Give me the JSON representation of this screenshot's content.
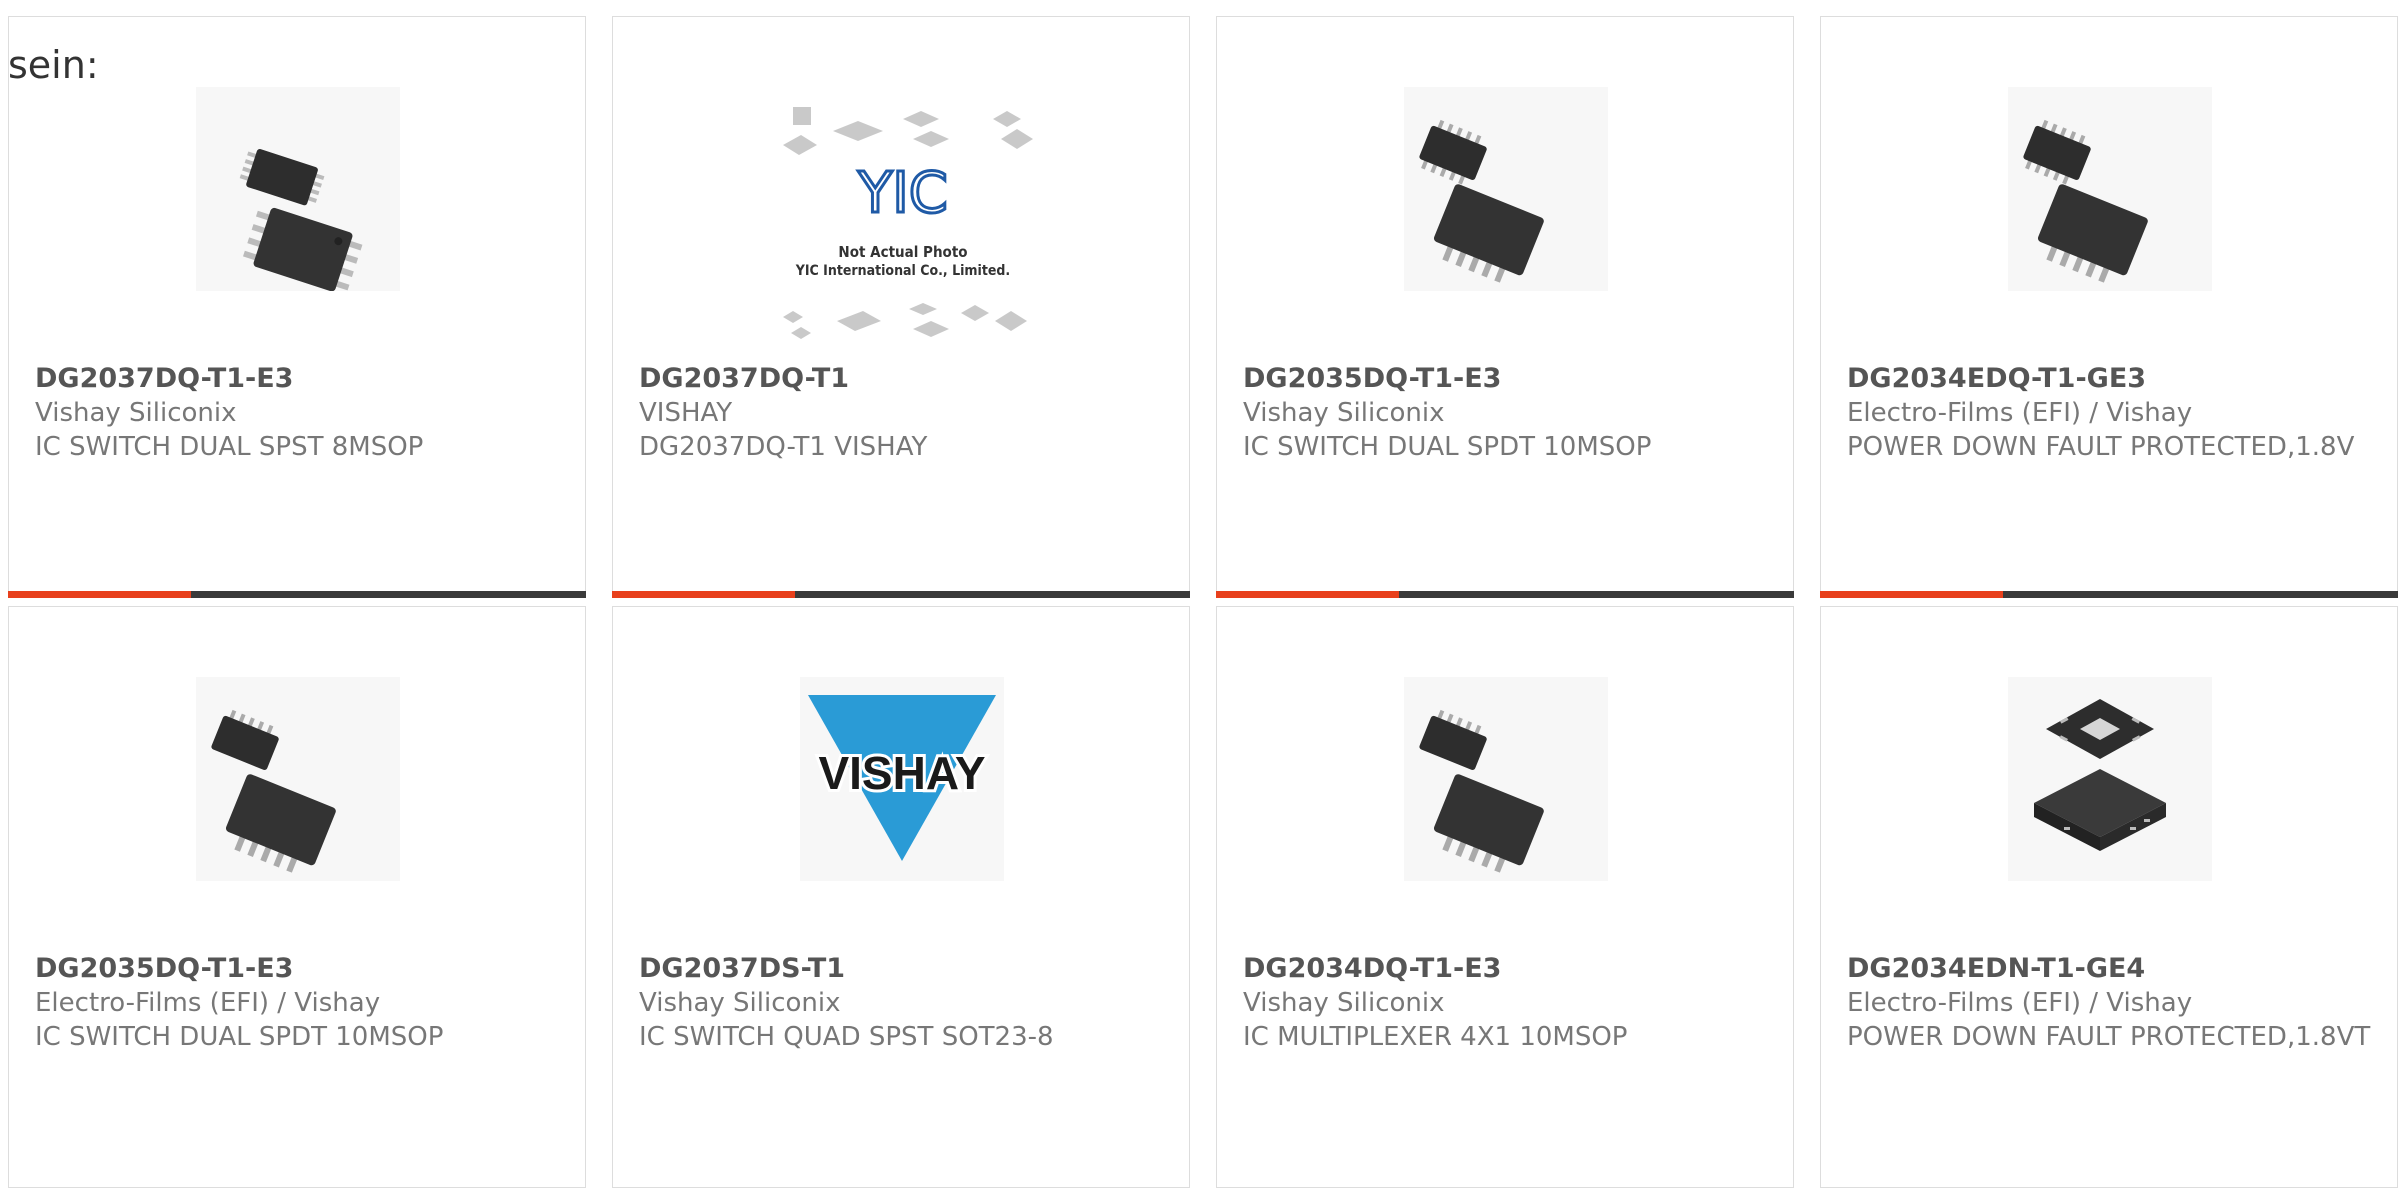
{
  "page": {
    "lead_text": "sein:",
    "accent_color": "#e8401c",
    "bar_color": "#3a3a3a"
  },
  "products": [
    {
      "part_number": "DG2037DQ-T1-E3",
      "manufacturer": "Vishay Siliconix",
      "description": "IC SWITCH DUAL SPST 8MSOP",
      "image": "msop-8-chip-photo",
      "has_accent_bar": true
    },
    {
      "part_number": "DG2037DQ-T1",
      "manufacturer": "VISHAY",
      "description": "DG2037DQ-T1 VISHAY",
      "image": "yic-placeholder-photo",
      "image_caption_line1": "Not Actual Photo",
      "image_caption_line2": "YIC International Co., Limited.",
      "image_logo_text": "YIC",
      "has_accent_bar": true
    },
    {
      "part_number": "DG2035DQ-T1-E3",
      "manufacturer": "Vishay Siliconix",
      "description": "IC SWITCH DUAL SPDT 10MSOP",
      "image": "msop-10-chip-photo",
      "has_accent_bar": true
    },
    {
      "part_number": "DG2034EDQ-T1-GE3",
      "manufacturer": "Electro-Films (EFI) / Vishay",
      "description": "POWER DOWN FAULT PROTECTED,1.8V",
      "image": "msop-10-chip-photo",
      "has_accent_bar": true
    },
    {
      "part_number": "DG2035DQ-T1-E3",
      "manufacturer": "Electro-Films (EFI) / Vishay",
      "description": "IC SWITCH DUAL SPDT 10MSOP",
      "image": "msop-10-chip-photo",
      "has_accent_bar": false
    },
    {
      "part_number": "DG2037DS-T1",
      "manufacturer": "Vishay Siliconix",
      "description": "IC SWITCH QUAD SPST SOT23-8",
      "image": "vishay-logo",
      "image_logo_text": "VISHAY",
      "has_accent_bar": false
    },
    {
      "part_number": "DG2034DQ-T1-E3",
      "manufacturer": "Vishay Siliconix",
      "description": "IC MULTIPLEXER 4X1 10MSOP",
      "image": "msop-10-chip-photo",
      "has_accent_bar": false
    },
    {
      "part_number": "DG2034EDN-T1-GE4",
      "manufacturer": "Electro-Films (EFI) / Vishay",
      "description": "POWER DOWN FAULT PROTECTED,1.8VT",
      "image": "qfn-chip-photo",
      "has_accent_bar": false
    }
  ]
}
